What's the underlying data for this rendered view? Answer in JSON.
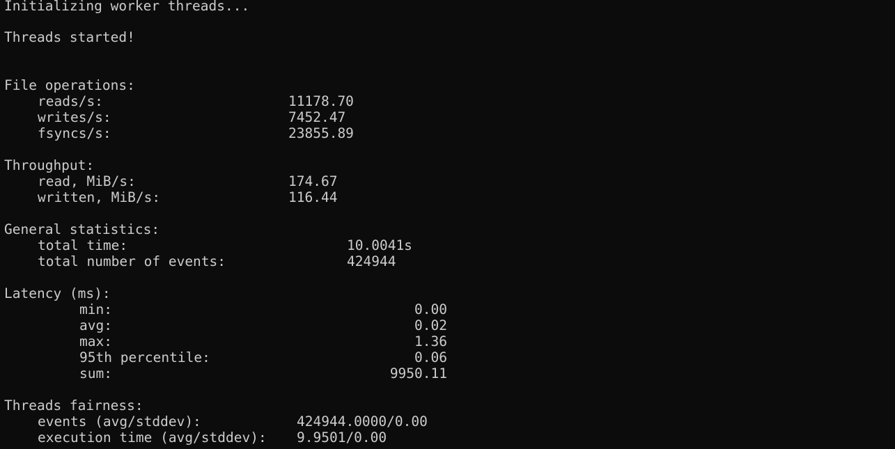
{
  "terminal": {
    "init_line": "Initializing worker threads...",
    "started_line": "Threads started!",
    "file_ops": {
      "heading": "File operations:",
      "reads_label": "reads/s:",
      "reads_value": "11178.70",
      "writes_label": "writes/s:",
      "writes_value": "7452.47",
      "fsyncs_label": "fsyncs/s:",
      "fsyncs_value": "23855.89"
    },
    "throughput": {
      "heading": "Throughput:",
      "read_label": "read, MiB/s:",
      "read_value": "174.67",
      "written_label": "written, MiB/s:",
      "written_value": "116.44"
    },
    "general": {
      "heading": "General statistics:",
      "total_time_label": "total time:",
      "total_time_value": "10.0041s",
      "events_label": "total number of events:",
      "events_value": "424944"
    },
    "latency": {
      "heading": "Latency (ms):",
      "min_label": "min:",
      "min_value": "0.00",
      "avg_label": "avg:",
      "avg_value": "0.02",
      "max_label": "max:",
      "max_value": "1.36",
      "p95_label": "95th percentile:",
      "p95_value": "0.06",
      "sum_label": "sum:",
      "sum_value": "9950.11"
    },
    "fairness": {
      "heading": "Threads fairness:",
      "events_label": "events (avg/stddev):",
      "events_value": "424944.0000/0.00",
      "exec_label": "execution time (avg/stddev):",
      "exec_value": "9.9501/0.00"
    }
  }
}
